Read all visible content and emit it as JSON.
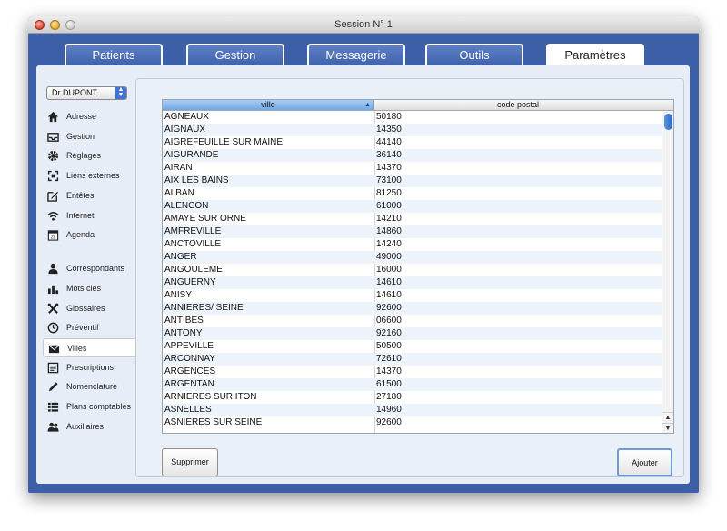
{
  "window": {
    "title": "Session N° 1"
  },
  "tabs": [
    {
      "label": "Patients"
    },
    {
      "label": "Gestion"
    },
    {
      "label": "Messagerie"
    },
    {
      "label": "Outils"
    },
    {
      "label": "Paramètres",
      "active": true
    }
  ],
  "doctor_select": {
    "value": "Dr DUPONT"
  },
  "sidebar": {
    "items": [
      {
        "label": "Adresse",
        "icon": "home-icon"
      },
      {
        "label": "Gestion",
        "icon": "inbox-icon"
      },
      {
        "label": "Réglages",
        "icon": "gear-icon"
      },
      {
        "label": "Liens externes",
        "icon": "external-links-icon"
      },
      {
        "label": "Entêtes",
        "icon": "edit-icon"
      },
      {
        "label": "Internet",
        "icon": "wifi-icon"
      },
      {
        "label": "Agenda",
        "icon": "calendar-icon"
      },
      {
        "label": "Correspondants",
        "icon": "person-icon"
      },
      {
        "label": "Mots clés",
        "icon": "bar-chart-icon"
      },
      {
        "label": "Glossaires",
        "icon": "tools-icon"
      },
      {
        "label": "Préventif",
        "icon": "clock-icon"
      },
      {
        "label": "Villes",
        "icon": "envelope-icon",
        "selected": true
      },
      {
        "label": "Prescriptions",
        "icon": "prescription-icon"
      },
      {
        "label": "Nomenclature",
        "icon": "pen-icon"
      },
      {
        "label": "Plans comptables",
        "icon": "list-icon"
      },
      {
        "label": "Auxiliaires",
        "icon": "group-icon"
      }
    ]
  },
  "table": {
    "columns": [
      "ville",
      "code postal"
    ],
    "rows": [
      [
        "AGNEAUX",
        "50180"
      ],
      [
        "AIGNAUX",
        "14350"
      ],
      [
        "AIGREFEUILLE SUR MAINE",
        "44140"
      ],
      [
        "AIGURANDE",
        "36140"
      ],
      [
        "AIRAN",
        "14370"
      ],
      [
        "AIX LES BAINS",
        "73100"
      ],
      [
        "ALBAN",
        "81250"
      ],
      [
        "ALENCON",
        "61000"
      ],
      [
        "AMAYE SUR ORNE",
        "14210"
      ],
      [
        "AMFREVILLE",
        "14860"
      ],
      [
        "ANCTOVILLE",
        "14240"
      ],
      [
        "ANGER",
        "49000"
      ],
      [
        "ANGOULEME",
        "16000"
      ],
      [
        "ANGUERNY",
        "14610"
      ],
      [
        "ANISY",
        "14610"
      ],
      [
        "ANNIERES/ SEINE",
        "92600"
      ],
      [
        "ANTIBES",
        "06600"
      ],
      [
        "ANTONY",
        "92160"
      ],
      [
        "APPEVILLE",
        "50500"
      ],
      [
        "ARCONNAY",
        "72610"
      ],
      [
        "ARGENCES",
        "14370"
      ],
      [
        "ARGENTAN",
        "61500"
      ],
      [
        "ARNIERES SUR ITON",
        "27180"
      ],
      [
        "ASNELLES",
        "14960"
      ],
      [
        "ASNIERES SUR SEINE",
        "92600"
      ]
    ]
  },
  "buttons": {
    "delete": "Supprimer",
    "add": "Ajouter"
  },
  "colors": {
    "window_bg": "#3c5fa8",
    "panel_bg": "#e7edf6",
    "sort_header": "#8dbaf0"
  }
}
